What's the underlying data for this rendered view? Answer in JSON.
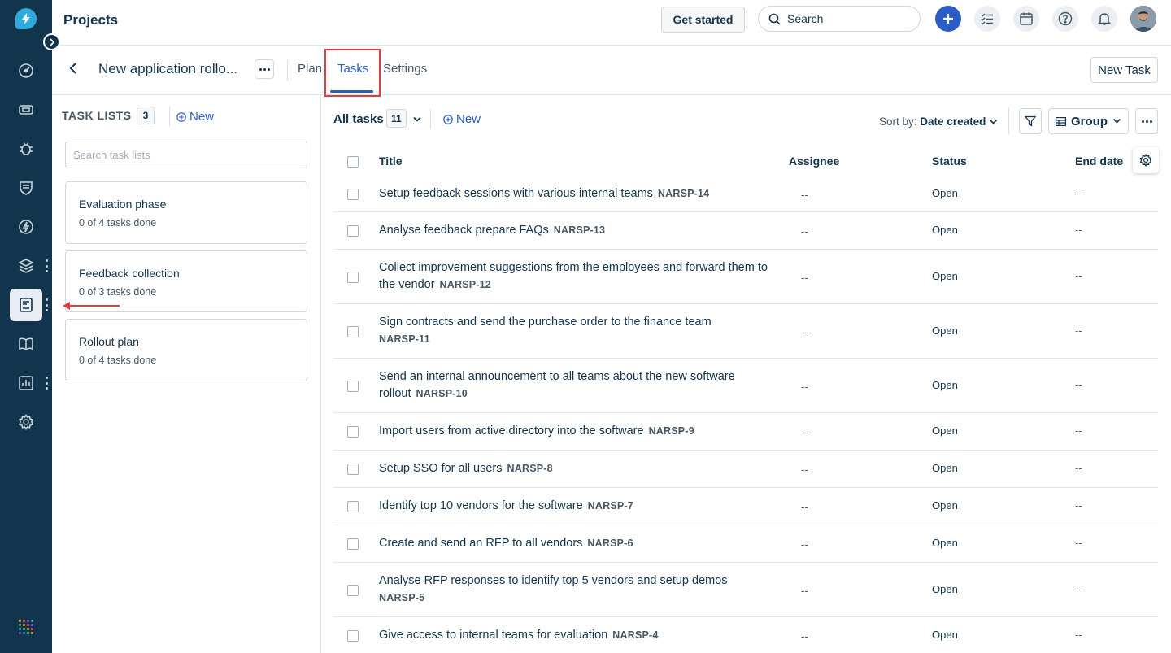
{
  "header": {
    "title": "Projects",
    "get_started": "Get started",
    "search_placeholder": "Search"
  },
  "project": {
    "name": "New application rollo...",
    "tabs": [
      {
        "label": "Plan"
      },
      {
        "label": "Tasks"
      },
      {
        "label": "Settings"
      }
    ],
    "active_tab": "Tasks",
    "new_task": "New Task"
  },
  "task_lists": {
    "heading": "TASK LISTS",
    "count": "3",
    "new_label": "New",
    "search_placeholder": "Search task lists",
    "items": [
      {
        "name": "Evaluation phase",
        "progress": "0 of 4 tasks done"
      },
      {
        "name": "Feedback collection",
        "progress": "0 of 3 tasks done"
      },
      {
        "name": "Rollout plan",
        "progress": "0 of 4 tasks done"
      }
    ]
  },
  "tasks": {
    "view_label": "All tasks",
    "count": "11",
    "new_label": "New",
    "sort_label": "Sort by:",
    "sort_value": "Date created",
    "group_label": "Group",
    "columns": [
      "Title",
      "Assignee",
      "Status",
      "End date"
    ],
    "rows": [
      {
        "title": "Setup feedback sessions with various internal teams",
        "key": "NARSP-14",
        "assignee": "--",
        "status": "Open",
        "end_date": "--"
      },
      {
        "title": "Analyse feedback prepare FAQs",
        "key": "NARSP-13",
        "assignee": "--",
        "status": "Open",
        "end_date": "--"
      },
      {
        "title": "Collect improvement suggestions from the employees and forward them to the vendor",
        "key": "NARSP-12",
        "assignee": "--",
        "status": "Open",
        "end_date": "--"
      },
      {
        "title": "Sign contracts and send the purchase order to the finance team",
        "key": "NARSP-11",
        "assignee": "--",
        "status": "Open",
        "end_date": "--"
      },
      {
        "title": "Send an internal announcement to all teams about the new software rollout",
        "key": "NARSP-10",
        "assignee": "--",
        "status": "Open",
        "end_date": "--"
      },
      {
        "title": "Import users from active directory into the software",
        "key": "NARSP-9",
        "assignee": "--",
        "status": "Open",
        "end_date": "--"
      },
      {
        "title": "Setup SSO for all users",
        "key": "NARSP-8",
        "assignee": "--",
        "status": "Open",
        "end_date": "--"
      },
      {
        "title": "Identify top 10 vendors for the software",
        "key": "NARSP-7",
        "assignee": "--",
        "status": "Open",
        "end_date": "--"
      },
      {
        "title": "Create and send an RFP to all vendors",
        "key": "NARSP-6",
        "assignee": "--",
        "status": "Open",
        "end_date": "--"
      },
      {
        "title": "Analyse RFP responses to identify top 5 vendors and setup demos",
        "key": "NARSP-5",
        "assignee": "--",
        "status": "Open",
        "end_date": "--"
      },
      {
        "title": "Give access to internal teams for evaluation",
        "key": "NARSP-4",
        "assignee": "--",
        "status": "Open",
        "end_date": "--"
      }
    ]
  },
  "sidebar": {
    "items": [
      {
        "icon": "dashboard-icon"
      },
      {
        "icon": "tickets-icon"
      },
      {
        "icon": "bug-icon"
      },
      {
        "icon": "shield-icon"
      },
      {
        "icon": "lightning-icon"
      },
      {
        "icon": "layers-icon"
      },
      {
        "icon": "projects-icon",
        "active": true
      },
      {
        "icon": "book-icon"
      },
      {
        "icon": "reports-icon"
      },
      {
        "icon": "settings-icon"
      }
    ]
  },
  "colors": {
    "rail": "#12344d",
    "accent": "#2c5cc5",
    "highlight": "#e03e3e",
    "logo": "#2eaadc"
  }
}
